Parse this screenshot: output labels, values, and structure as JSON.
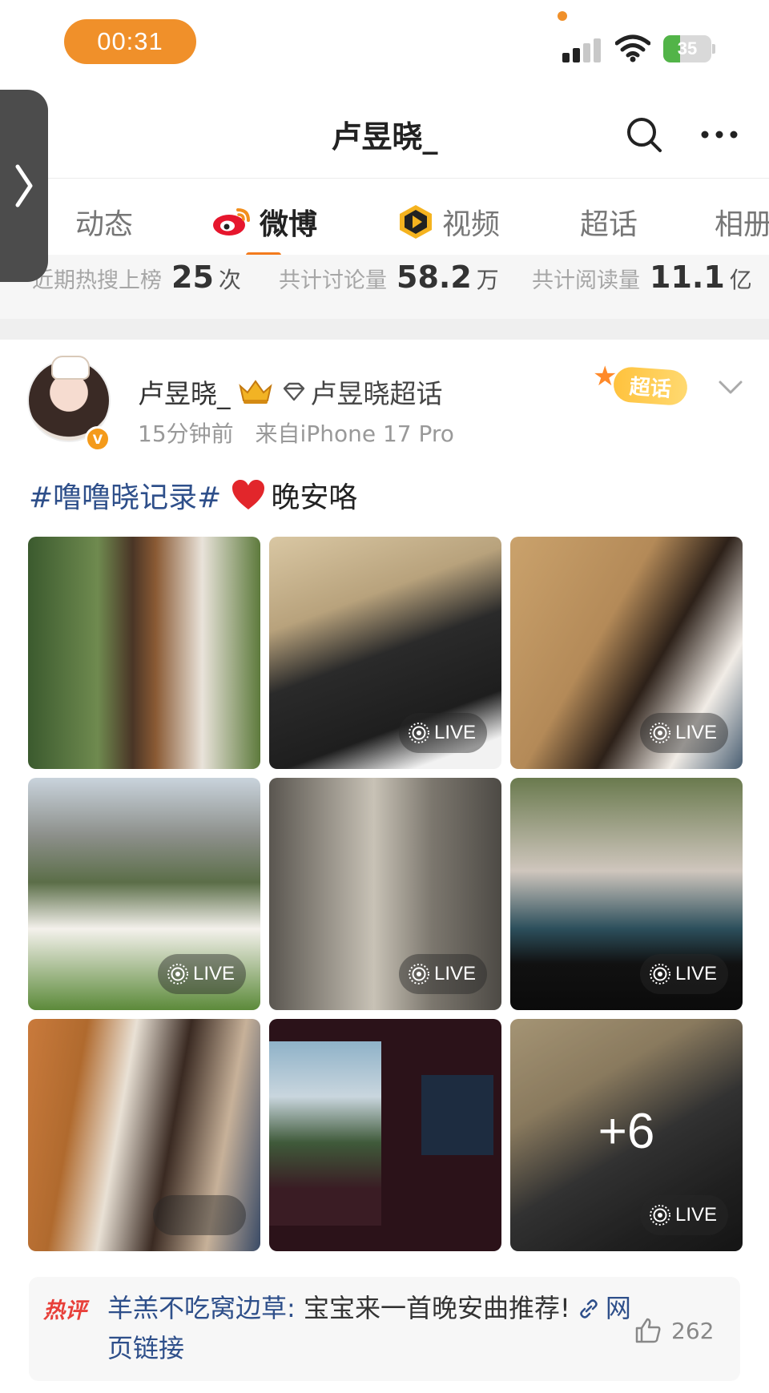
{
  "status_bar": {
    "time": "00:31",
    "battery": "35",
    "battery_level": 0.35
  },
  "nav": {
    "title": "卢昱晓_"
  },
  "tabs": [
    {
      "label": "动态",
      "active": false
    },
    {
      "label": "微博",
      "active": true
    },
    {
      "label": "视频",
      "active": false
    },
    {
      "label": "超话",
      "active": false
    },
    {
      "label": "相册",
      "active": false
    }
  ],
  "stats": [
    {
      "label": "近期热搜上榜",
      "value": "25",
      "unit": "次"
    },
    {
      "label": "共计讨论量",
      "value": "58.2",
      "unit": "万"
    },
    {
      "label": "共计阅读量",
      "value": "11.1",
      "unit": "亿"
    }
  ],
  "post": {
    "author": "卢昱晓_",
    "topic": "卢昱晓超话",
    "time": "15分钟前",
    "source": "来自iPhone 17 Pro",
    "badge_label": "超话",
    "verified_badge": "V",
    "hashtag": "#噜噜晓记录#",
    "body": "晚安咯",
    "live_label": "LIVE",
    "more_count": "+6"
  },
  "hot_comment": {
    "tag": "热评",
    "user": "羊羔不吃窝边草:",
    "text": " 宝宝来一首晚安曲推荐!",
    "link": "网页链接",
    "likes": "262"
  },
  "colors": {
    "accent": "#f37b1d",
    "link": "#2e4f8a",
    "hot": "#e8403a"
  }
}
